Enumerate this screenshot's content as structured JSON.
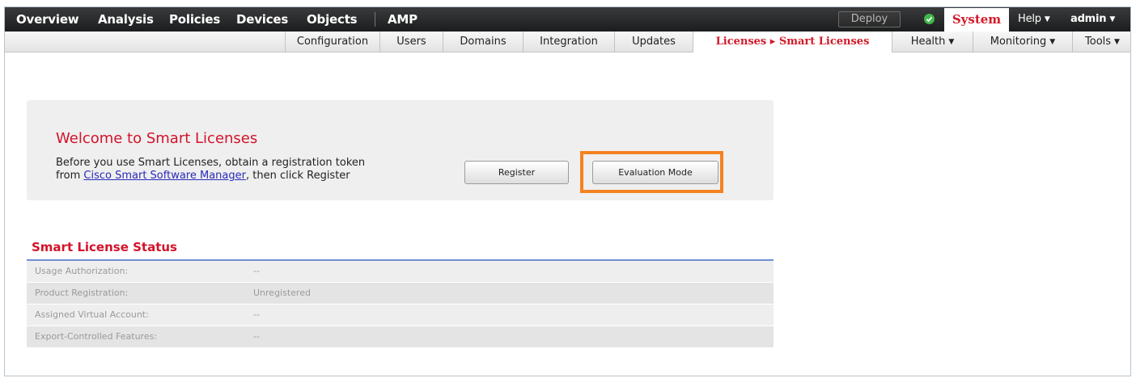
{
  "top_nav": {
    "items": [
      "Overview",
      "Analysis",
      "Policies",
      "Devices",
      "Objects",
      "AMP"
    ],
    "deploy_label": "Deploy",
    "system_label": "System",
    "help_label": "Help",
    "admin_label": "admin",
    "status_icon": "check-circle-icon",
    "status_color": "#3fb84a"
  },
  "sub_nav": {
    "items": [
      "Configuration",
      "Users",
      "Domains",
      "Integration",
      "Updates",
      "Licenses ▸ Smart Licenses",
      "Health",
      "Monitoring",
      "Tools"
    ],
    "active": "Licenses ▸ Smart Licenses"
  },
  "welcome": {
    "title": "Welcome to Smart Licenses",
    "line1": "Before you use Smart Licenses, obtain a registration token",
    "line2_prefix": "from ",
    "link_text": "Cisco Smart Software Manager",
    "line2_suffix": ", then click Register",
    "register_label": "Register",
    "evaluation_label": "Evaluation Mode",
    "highlight_color": "#f5821f"
  },
  "status": {
    "title": "Smart License Status",
    "rows": [
      {
        "label": "Usage Authorization:",
        "value": "--"
      },
      {
        "label": "Product Registration:",
        "value": "Unregistered"
      },
      {
        "label": "Assigned Virtual Account:",
        "value": "--"
      },
      {
        "label": "Export-Controlled Features:",
        "value": "--"
      }
    ]
  },
  "colors": {
    "accent_red": "#d2132a",
    "nav_dark": "#2a2b2c"
  }
}
